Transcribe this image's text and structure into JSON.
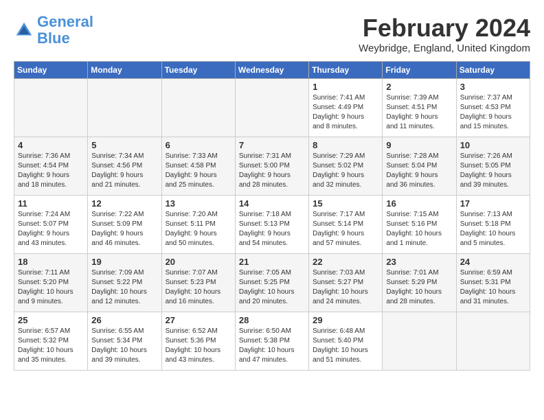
{
  "header": {
    "logo_line1": "General",
    "logo_line2": "Blue",
    "month": "February 2024",
    "location": "Weybridge, England, United Kingdom"
  },
  "weekdays": [
    "Sunday",
    "Monday",
    "Tuesday",
    "Wednesday",
    "Thursday",
    "Friday",
    "Saturday"
  ],
  "weeks": [
    [
      {
        "day": "",
        "info": ""
      },
      {
        "day": "",
        "info": ""
      },
      {
        "day": "",
        "info": ""
      },
      {
        "day": "",
        "info": ""
      },
      {
        "day": "1",
        "info": "Sunrise: 7:41 AM\nSunset: 4:49 PM\nDaylight: 9 hours\nand 8 minutes."
      },
      {
        "day": "2",
        "info": "Sunrise: 7:39 AM\nSunset: 4:51 PM\nDaylight: 9 hours\nand 11 minutes."
      },
      {
        "day": "3",
        "info": "Sunrise: 7:37 AM\nSunset: 4:53 PM\nDaylight: 9 hours\nand 15 minutes."
      }
    ],
    [
      {
        "day": "4",
        "info": "Sunrise: 7:36 AM\nSunset: 4:54 PM\nDaylight: 9 hours\nand 18 minutes."
      },
      {
        "day": "5",
        "info": "Sunrise: 7:34 AM\nSunset: 4:56 PM\nDaylight: 9 hours\nand 21 minutes."
      },
      {
        "day": "6",
        "info": "Sunrise: 7:33 AM\nSunset: 4:58 PM\nDaylight: 9 hours\nand 25 minutes."
      },
      {
        "day": "7",
        "info": "Sunrise: 7:31 AM\nSunset: 5:00 PM\nDaylight: 9 hours\nand 28 minutes."
      },
      {
        "day": "8",
        "info": "Sunrise: 7:29 AM\nSunset: 5:02 PM\nDaylight: 9 hours\nand 32 minutes."
      },
      {
        "day": "9",
        "info": "Sunrise: 7:28 AM\nSunset: 5:04 PM\nDaylight: 9 hours\nand 36 minutes."
      },
      {
        "day": "10",
        "info": "Sunrise: 7:26 AM\nSunset: 5:05 PM\nDaylight: 9 hours\nand 39 minutes."
      }
    ],
    [
      {
        "day": "11",
        "info": "Sunrise: 7:24 AM\nSunset: 5:07 PM\nDaylight: 9 hours\nand 43 minutes."
      },
      {
        "day": "12",
        "info": "Sunrise: 7:22 AM\nSunset: 5:09 PM\nDaylight: 9 hours\nand 46 minutes."
      },
      {
        "day": "13",
        "info": "Sunrise: 7:20 AM\nSunset: 5:11 PM\nDaylight: 9 hours\nand 50 minutes."
      },
      {
        "day": "14",
        "info": "Sunrise: 7:18 AM\nSunset: 5:13 PM\nDaylight: 9 hours\nand 54 minutes."
      },
      {
        "day": "15",
        "info": "Sunrise: 7:17 AM\nSunset: 5:14 PM\nDaylight: 9 hours\nand 57 minutes."
      },
      {
        "day": "16",
        "info": "Sunrise: 7:15 AM\nSunset: 5:16 PM\nDaylight: 10 hours\nand 1 minute."
      },
      {
        "day": "17",
        "info": "Sunrise: 7:13 AM\nSunset: 5:18 PM\nDaylight: 10 hours\nand 5 minutes."
      }
    ],
    [
      {
        "day": "18",
        "info": "Sunrise: 7:11 AM\nSunset: 5:20 PM\nDaylight: 10 hours\nand 9 minutes."
      },
      {
        "day": "19",
        "info": "Sunrise: 7:09 AM\nSunset: 5:22 PM\nDaylight: 10 hours\nand 12 minutes."
      },
      {
        "day": "20",
        "info": "Sunrise: 7:07 AM\nSunset: 5:23 PM\nDaylight: 10 hours\nand 16 minutes."
      },
      {
        "day": "21",
        "info": "Sunrise: 7:05 AM\nSunset: 5:25 PM\nDaylight: 10 hours\nand 20 minutes."
      },
      {
        "day": "22",
        "info": "Sunrise: 7:03 AM\nSunset: 5:27 PM\nDaylight: 10 hours\nand 24 minutes."
      },
      {
        "day": "23",
        "info": "Sunrise: 7:01 AM\nSunset: 5:29 PM\nDaylight: 10 hours\nand 28 minutes."
      },
      {
        "day": "24",
        "info": "Sunrise: 6:59 AM\nSunset: 5:31 PM\nDaylight: 10 hours\nand 31 minutes."
      }
    ],
    [
      {
        "day": "25",
        "info": "Sunrise: 6:57 AM\nSunset: 5:32 PM\nDaylight: 10 hours\nand 35 minutes."
      },
      {
        "day": "26",
        "info": "Sunrise: 6:55 AM\nSunset: 5:34 PM\nDaylight: 10 hours\nand 39 minutes."
      },
      {
        "day": "27",
        "info": "Sunrise: 6:52 AM\nSunset: 5:36 PM\nDaylight: 10 hours\nand 43 minutes."
      },
      {
        "day": "28",
        "info": "Sunrise: 6:50 AM\nSunset: 5:38 PM\nDaylight: 10 hours\nand 47 minutes."
      },
      {
        "day": "29",
        "info": "Sunrise: 6:48 AM\nSunset: 5:40 PM\nDaylight: 10 hours\nand 51 minutes."
      },
      {
        "day": "",
        "info": ""
      },
      {
        "day": "",
        "info": ""
      }
    ]
  ]
}
